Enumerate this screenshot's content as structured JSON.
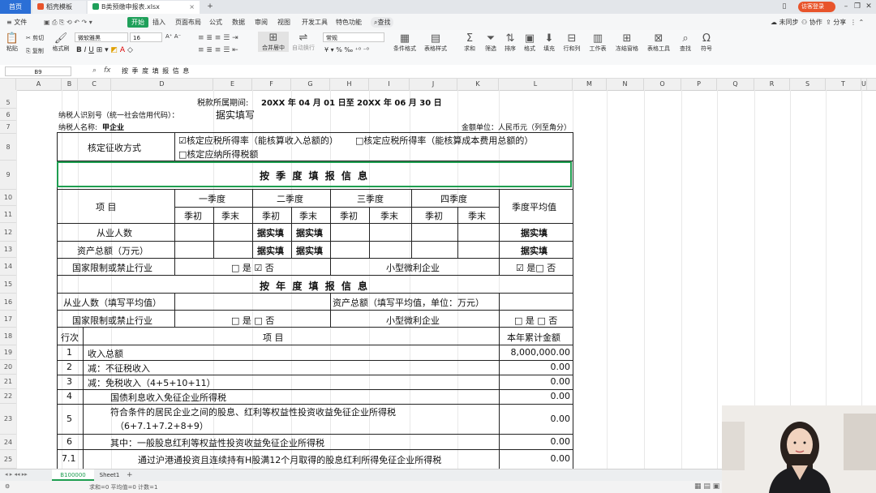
{
  "tabs": {
    "home": "首页",
    "t1": "稻壳模板",
    "t2": "B类预缴申报表.xlsx"
  },
  "user_badge": "访客登录",
  "menu": [
    "文件",
    "开始",
    "插入",
    "页面布局",
    "公式",
    "数据",
    "审阅",
    "视图",
    "开发工具",
    "特色功能",
    "查找"
  ],
  "menu_right": [
    "未同步",
    "协作",
    "分享"
  ],
  "ribbon": {
    "cut": "剪切",
    "copy": "复制",
    "format_painter": "格式刷",
    "paste": "粘贴",
    "font_name": "微软雅黑",
    "font_size": "16",
    "merge": "合并居中",
    "wrap": "自动换行",
    "number_format": "常规",
    "big": [
      "条件格式",
      "表格样式",
      "求和",
      "筛选",
      "排序",
      "格式",
      "填充",
      "行和列",
      "工作表",
      "冻结窗格",
      "表格工具",
      "查找",
      "符号"
    ]
  },
  "formula_bar": {
    "cell_ref": "B9",
    "fx": "fx",
    "content": "按 季 度 填 报 信 息"
  },
  "columns": [
    "A",
    "B",
    "C",
    "D",
    "E",
    "F",
    "G",
    "H",
    "I",
    "J",
    "K",
    "L",
    "M",
    "N",
    "O",
    "P",
    "Q",
    "R",
    "S",
    "T",
    "U"
  ],
  "rows": [
    "5",
    "6",
    "7",
    "8",
    "9",
    "10",
    "11",
    "12",
    "13",
    "14",
    "15",
    "16",
    "17",
    "18",
    "19",
    "20",
    "21",
    "22",
    "23",
    "24",
    "25"
  ],
  "sheet": {
    "period_label": "税款所属期间:",
    "period_value": "20XX 年 04 月 01 日至  20XX 年  06 月 30 日",
    "taxpayer_id": "纳税人识别号（统一社会信用代码）：",
    "fill_note": "据实填写",
    "taxpayer_name_label": "纳税人名称:",
    "taxpayer_name": "甲企业",
    "currency": "金额单位：人民币元（列至角分）",
    "method_label": "核定征收方式",
    "method_opt1": "☑核定应税所得率（能核算收入总额的）",
    "method_opt2": "□核定应税所得率（能核算成本费用总额的）",
    "method_opt3": "□核定应纳所得税额",
    "quarter_section": "按 季 度 填 报 信 息",
    "item": "项        目",
    "q1": "一季度",
    "q2": "二季度",
    "q3": "三季度",
    "q4": "四季度",
    "q_begin": "季初",
    "q_end": "季末",
    "q_avg": "季度平均值",
    "employees": "从业人数",
    "assets": "资产总额（万元）",
    "fill_actual": "据实填",
    "restricted": "国家限制或禁止行业",
    "restricted_q_value": "□ 是 ☑ 否",
    "small_micro": "小型微利企业",
    "small_micro_q_value": "☑ 是□ 否",
    "year_section": "按 年 度 填 报 信 息",
    "employees_year": "从业人数（填写平均值）",
    "assets_year": "资产总额（填写平均值，单位：万元）",
    "restricted_y_value": "□ 是 □ 否",
    "small_micro_y_value": "□ 是  □ 否",
    "line_no": "行次",
    "item2": "项        目",
    "ytd": "本年累计金额",
    "lines": [
      {
        "no": "1",
        "text": "收入总额",
        "value": "8,000,000.00"
      },
      {
        "no": "2",
        "text": "减：不征税收入",
        "value": "0.00"
      },
      {
        "no": "3",
        "text": "减：免税收入（4+5+10+11）",
        "value": "0.00"
      },
      {
        "no": "4",
        "text": "国债利息收入免征企业所得税",
        "value": "0.00"
      },
      {
        "no": "5",
        "text": "符合条件的居民企业之间的股息、红利等权益性投资收益免征企业所得税",
        "text2": "（6+7.1+7.2+8+9）",
        "value": "0.00"
      },
      {
        "no": "6",
        "text": "其中：一般股息红利等权益性投资收益免征企业所得税",
        "value": "0.00"
      },
      {
        "no": "7.1",
        "text": "通过沪港通投资且连续持有H股满12个月取得的股息红利所得免征企业所得税",
        "value": "0.00"
      }
    ]
  },
  "sheet_tabs": [
    "B100000",
    "Sheet1"
  ],
  "status": "求和=0  平均值=0  计数=1"
}
